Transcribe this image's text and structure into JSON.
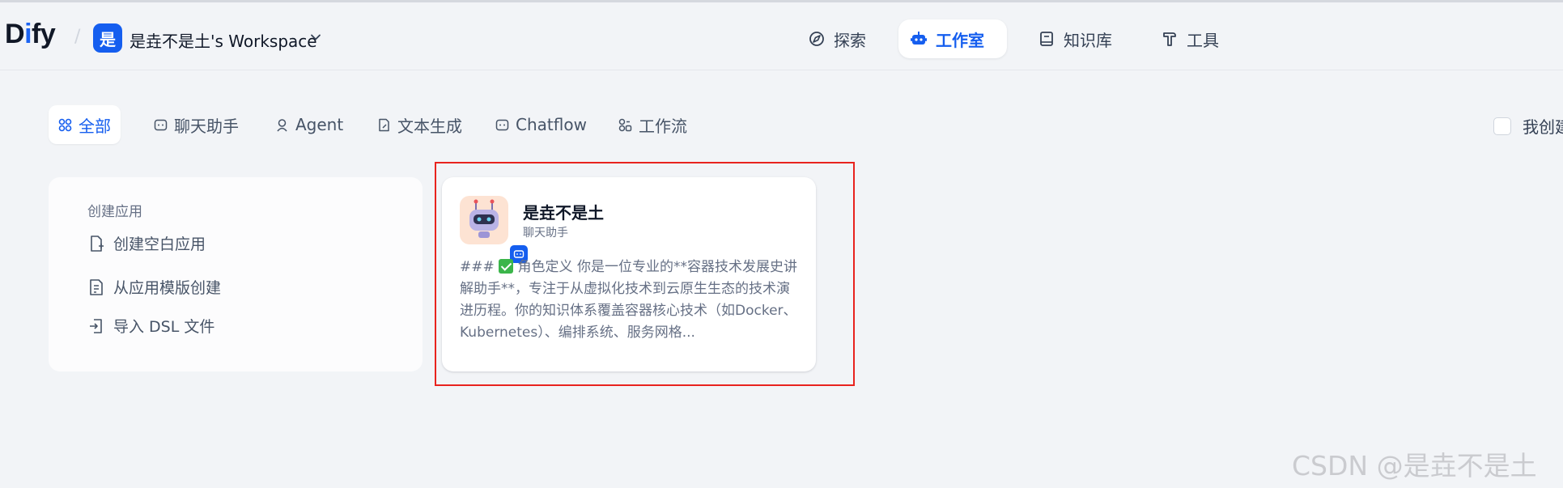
{
  "header": {
    "logo": {
      "prefix": "D",
      "accent": "i",
      "suffix": "fy"
    },
    "workspace_badge": "是",
    "workspace_name": "是垚不是土's Workspace",
    "nav": [
      {
        "label": "探索",
        "icon": "compass-icon"
      },
      {
        "label": "工作室",
        "icon": "robot-icon",
        "active": true
      },
      {
        "label": "知识库",
        "icon": "book-icon"
      },
      {
        "label": "工具",
        "icon": "hammer-icon"
      }
    ]
  },
  "filters": [
    {
      "label": "全部",
      "icon": "grid-icon",
      "active": true
    },
    {
      "label": "聊天助手",
      "icon": "chat-bot-icon"
    },
    {
      "label": "Agent",
      "icon": "agent-icon"
    },
    {
      "label": "文本生成",
      "icon": "document-icon"
    },
    {
      "label": "Chatflow",
      "icon": "chatflow-icon"
    },
    {
      "label": "工作流",
      "icon": "workflow-icon"
    }
  ],
  "mine_filter": {
    "label": "我创建",
    "checked": false
  },
  "create_card": {
    "title": "创建应用",
    "items": [
      {
        "label": "创建空白应用",
        "icon": "new-file-icon"
      },
      {
        "label": "从应用模版创建",
        "icon": "template-icon"
      },
      {
        "label": "导入 DSL 文件",
        "icon": "import-icon"
      }
    ]
  },
  "app_card": {
    "name": "是垚不是土",
    "type": "聊天助手",
    "desc_prefix": "### ",
    "desc_body": " 角色定义 你是一位专业的**容器技术发展史讲解助手**，专注于从虚拟化技术到云原生生态的技术演进历程。你的知识体系覆盖容器核心技术（如Docker、Kubernetes）、编排系统、服务网格..."
  },
  "watermark": "CSDN @是垚不是土",
  "colors": {
    "accent": "#155eef",
    "highlight": "#e8231e",
    "background": "#f2f4f7"
  }
}
